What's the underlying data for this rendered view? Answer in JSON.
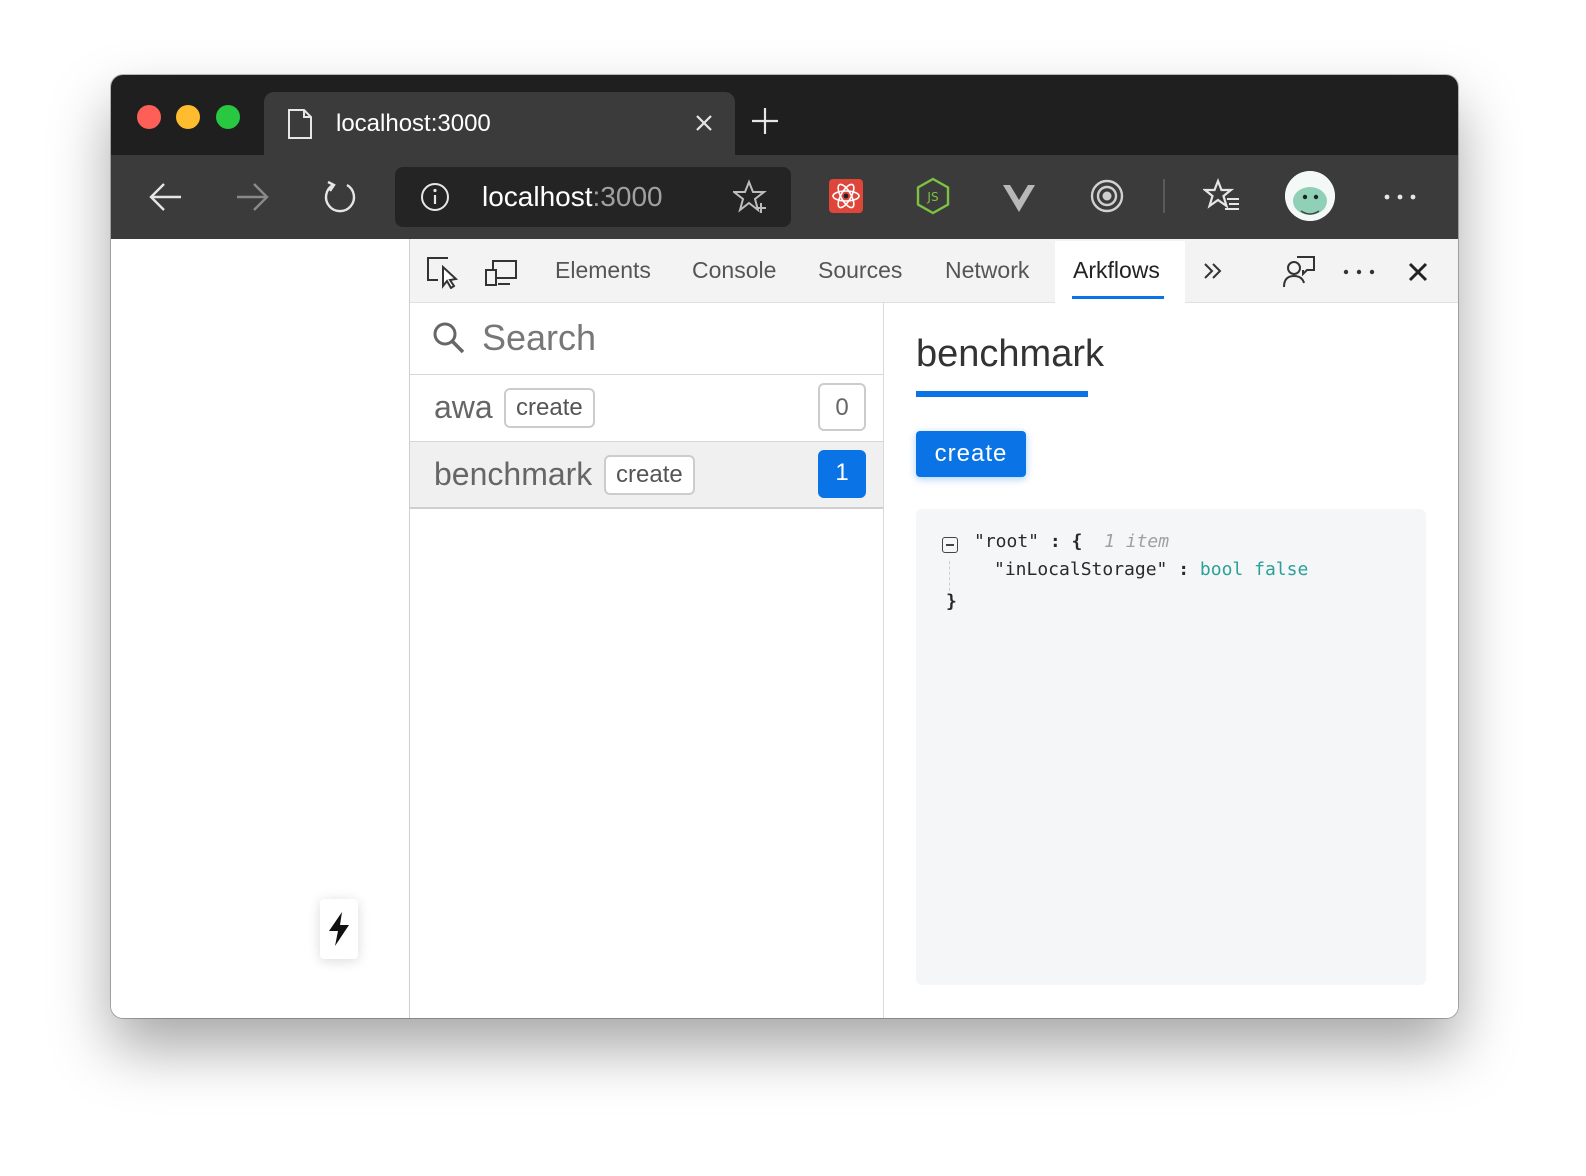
{
  "window": {
    "tab_title": "localhost:3000",
    "address_host": "localhost",
    "address_port": ":3000"
  },
  "devtools": {
    "tabs": [
      "Elements",
      "Console",
      "Sources",
      "Network",
      "Arkflows"
    ],
    "active_tab": "Arkflows"
  },
  "panel": {
    "search_placeholder": "Search",
    "flows": [
      {
        "name": "awa",
        "badge": "create",
        "count": "0"
      },
      {
        "name": "benchmark",
        "badge": "create",
        "count": "1"
      }
    ]
  },
  "detail": {
    "title": "benchmark",
    "action_button": "create",
    "json": {
      "root_key": "\"root\"",
      "open_brace": ": {",
      "item_count": "1 item",
      "field_key": "\"inLocalStorage\"",
      "field_sep": ":",
      "field_type": "bool",
      "field_value": "false",
      "close_brace": "}"
    }
  },
  "colors": {
    "accent": "#0a74e6",
    "tabstrip": "#1f1f1f",
    "toolbar": "#3b3b3b",
    "json_type": "#2aa198"
  }
}
